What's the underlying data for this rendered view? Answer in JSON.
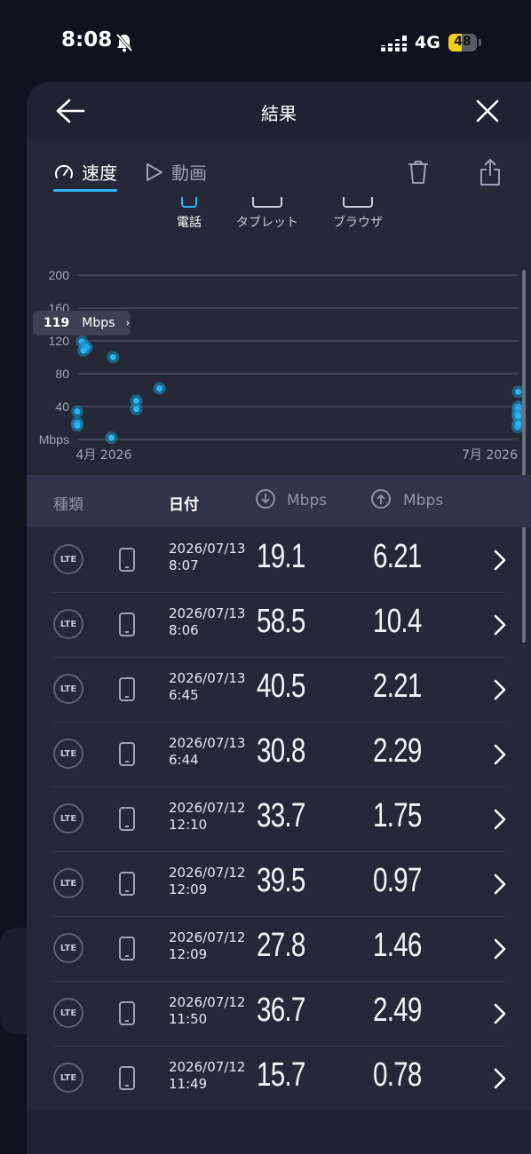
{
  "status_bar": {
    "time": "8:08",
    "network": "4G",
    "battery": "48",
    "battery_fraction": 0.48
  },
  "header": {
    "title": "結果"
  },
  "tabs": [
    {
      "label": "速度",
      "icon": "speedometer-icon",
      "active": true
    },
    {
      "label": "動画",
      "icon": "play-icon",
      "active": false
    }
  ],
  "device_filter": [
    {
      "label": "電話",
      "icon": "phone-device-icon",
      "active": true
    },
    {
      "label": "タブレット",
      "icon": "tablet-device-icon",
      "active": false
    },
    {
      "label": "ブラウザ",
      "icon": "browser-device-icon",
      "active": false
    }
  ],
  "chart_data": {
    "type": "scatter",
    "y_ticks": [
      "200",
      "160",
      "120",
      "80",
      "40"
    ],
    "ylabel": "Mbps",
    "ylim": [
      0,
      200
    ],
    "x_tick_labels": [
      "4月 2026",
      "7月 2026"
    ],
    "tooltip": {
      "value": "119",
      "unit": "Mbps"
    },
    "grid": true,
    "points_left_cluster": [
      {
        "x": 0.0,
        "y": 34
      },
      {
        "x": 0.0,
        "y": 20
      },
      {
        "x": 0.0,
        "y": 17
      },
      {
        "x": 0.03,
        "y": 119
      },
      {
        "x": 0.05,
        "y": 113
      },
      {
        "x": 0.06,
        "y": 112
      },
      {
        "x": 0.04,
        "y": 108
      },
      {
        "x": 0.23,
        "y": 100
      },
      {
        "x": 0.22,
        "y": 2
      },
      {
        "x": 0.38,
        "y": 47
      },
      {
        "x": 0.38,
        "y": 37
      },
      {
        "x": 0.53,
        "y": 62
      }
    ],
    "points_right_cluster": [
      {
        "x": 0.99,
        "y": 58
      },
      {
        "x": 0.99,
        "y": 40
      },
      {
        "x": 0.98,
        "y": 36
      },
      {
        "x": 0.97,
        "y": 30
      },
      {
        "x": 0.99,
        "y": 28
      },
      {
        "x": 0.97,
        "y": 15
      },
      {
        "x": 0.99,
        "y": 19
      }
    ]
  },
  "table": {
    "headers": {
      "type": "種類",
      "date": "日付",
      "download": "Mbps",
      "upload": "Mbps"
    },
    "rows": [
      {
        "tech": "LTE",
        "date": "2026/07/13",
        "time": "8:07",
        "down": "19.1",
        "up": "6.21"
      },
      {
        "tech": "LTE",
        "date": "2026/07/13",
        "time": "8:06",
        "down": "58.5",
        "up": "10.4"
      },
      {
        "tech": "LTE",
        "date": "2026/07/13",
        "time": "6:45",
        "down": "40.5",
        "up": "2.21"
      },
      {
        "tech": "LTE",
        "date": "2026/07/13",
        "time": "6:44",
        "down": "30.8",
        "up": "2.29"
      },
      {
        "tech": "LTE",
        "date": "2026/07/12",
        "time": "12:10",
        "down": "33.7",
        "up": "1.75"
      },
      {
        "tech": "LTE",
        "date": "2026/07/12",
        "time": "12:09",
        "down": "39.5",
        "up": "0.97"
      },
      {
        "tech": "LTE",
        "date": "2026/07/12",
        "time": "12:09",
        "down": "27.8",
        "up": "1.46"
      },
      {
        "tech": "LTE",
        "date": "2026/07/12",
        "time": "11:50",
        "down": "36.7",
        "up": "2.49"
      },
      {
        "tech": "LTE",
        "date": "2026/07/12",
        "time": "11:49",
        "down": "15.7",
        "up": "0.78"
      }
    ]
  },
  "colors": {
    "accent": "#2fb3f0",
    "sheet": "#252837",
    "background": "#10131e"
  }
}
